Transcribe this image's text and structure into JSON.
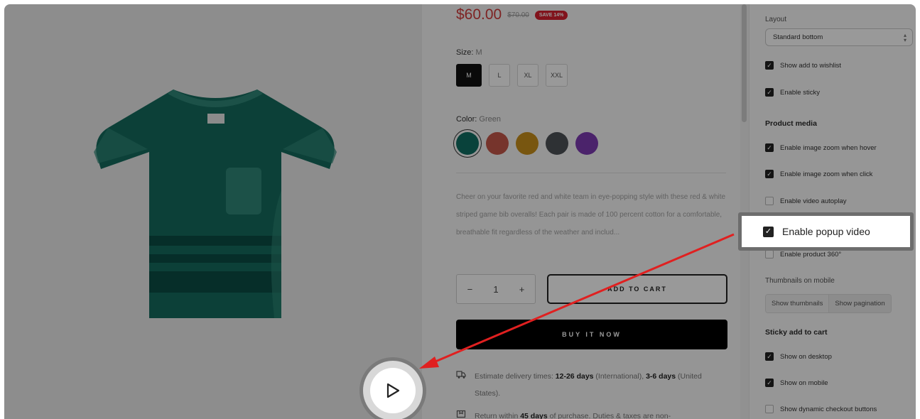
{
  "product": {
    "price": "$60.00",
    "compare_price": "$70.00",
    "badge": "SAVE 14%",
    "size_label": "Size:",
    "size_value": "M",
    "sizes": [
      "M",
      "L",
      "XL",
      "XXL"
    ],
    "selected_size": "M",
    "color_label": "Color:",
    "color_value": "Green",
    "colors": [
      "#0f6f63",
      "#c5584a",
      "#c9901c",
      "#4e5258",
      "#7d3bb3"
    ],
    "description": "Cheer on your favorite red and white team in eye-popping style with these red & white striped game bib overalls! Each pair is made of 100 percent cotton for a comfortable, breathable fit regardless of the weather and includ...",
    "quantity": "1",
    "qty_minus": "−",
    "qty_plus": "+",
    "add_to_cart": "ADD TO CART",
    "buy_now": "BUY IT NOW",
    "delivery": {
      "prefix": "Estimate delivery times: ",
      "intl_days": "12-26 days",
      "intl_label": " (International), ",
      "us_days": "3-6 days",
      "us_label": " (United States)."
    },
    "returns": {
      "prefix": "Return within ",
      "days": "45 days",
      "suffix": " of purchase. Duties & taxes are non-"
    },
    "accent_green": "#0f6f63"
  },
  "settings": {
    "layout_label": "Layout",
    "layout_value": "Standard bottom",
    "show_wishlist": "Show add to wishlist",
    "enable_sticky": "Enable sticky",
    "product_media_heading": "Product media",
    "zoom_hover": "Enable image zoom when hover",
    "zoom_click": "Enable image zoom when click",
    "video_autoplay": "Enable video autoplay",
    "popup_video": "Enable popup video",
    "product_360": "Enable product 360°",
    "thumbnails_mobile_label": "Thumbnails on mobile",
    "show_thumbnails": "Show thumbnails",
    "show_pagination": "Show pagination",
    "sticky_heading": "Sticky add to cart",
    "show_desktop": "Show on desktop",
    "show_mobile": "Show on mobile",
    "dynamic_checkout": "Show dynamic checkout buttons"
  },
  "icons": {
    "checkmark": "✓",
    "play": "play-icon",
    "truck": "truck-icon",
    "return": "return-box-icon"
  },
  "annotation_color": "#e02020"
}
